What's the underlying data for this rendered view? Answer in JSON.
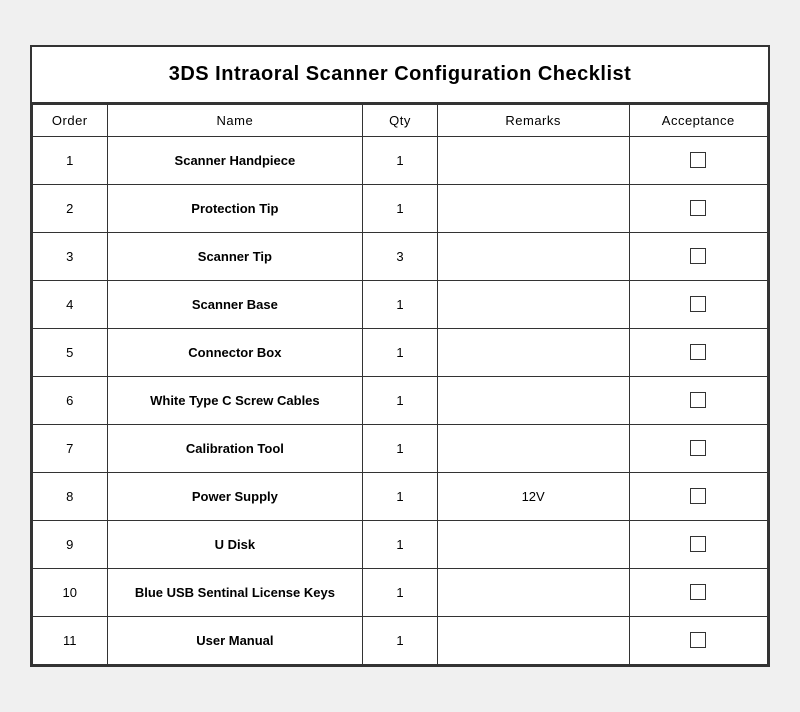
{
  "title": "3DS Intraoral Scanner Configuration Checklist",
  "columns": [
    {
      "key": "order",
      "label": "Order"
    },
    {
      "key": "name",
      "label": "Name"
    },
    {
      "key": "qty",
      "label": "Qty"
    },
    {
      "key": "remarks",
      "label": "Remarks"
    },
    {
      "key": "acceptance",
      "label": "Acceptance"
    }
  ],
  "rows": [
    {
      "order": "1",
      "name": "Scanner Handpiece",
      "qty": "1",
      "remarks": "",
      "acceptance": ""
    },
    {
      "order": "2",
      "name": "Protection Tip",
      "qty": "1",
      "remarks": "",
      "acceptance": ""
    },
    {
      "order": "3",
      "name": "Scanner Tip",
      "qty": "3",
      "remarks": "",
      "acceptance": ""
    },
    {
      "order": "4",
      "name": "Scanner Base",
      "qty": "1",
      "remarks": "",
      "acceptance": ""
    },
    {
      "order": "5",
      "name": "Connector Box",
      "qty": "1",
      "remarks": "",
      "acceptance": ""
    },
    {
      "order": "6",
      "name": "White Type C Screw Cables",
      "qty": "1",
      "remarks": "",
      "acceptance": ""
    },
    {
      "order": "7",
      "name": "Calibration Tool",
      "qty": "1",
      "remarks": "",
      "acceptance": ""
    },
    {
      "order": "8",
      "name": "Power Supply",
      "qty": "1",
      "remarks": "12V",
      "acceptance": ""
    },
    {
      "order": "9",
      "name": "U Disk",
      "qty": "1",
      "remarks": "",
      "acceptance": ""
    },
    {
      "order": "10",
      "name": "Blue USB Sentinal License Keys",
      "qty": "1",
      "remarks": "",
      "acceptance": ""
    },
    {
      "order": "11",
      "name": "User Manual",
      "qty": "1",
      "remarks": "",
      "acceptance": ""
    }
  ]
}
